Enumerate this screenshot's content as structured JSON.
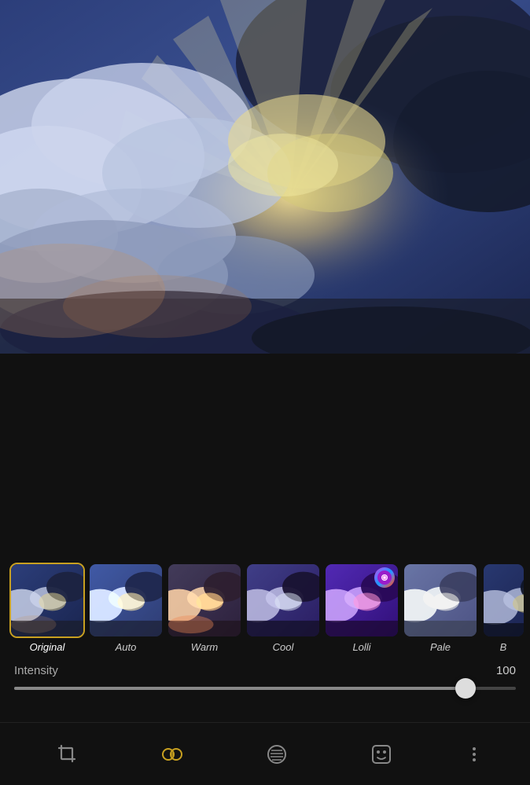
{
  "photo": {
    "alt": "Sky with dramatic clouds and sunbeams"
  },
  "filters": [
    {
      "id": "original",
      "label": "Original",
      "active": true,
      "badge": false
    },
    {
      "id": "auto",
      "label": "Auto",
      "active": false,
      "badge": false
    },
    {
      "id": "warm",
      "label": "Warm",
      "active": false,
      "badge": false
    },
    {
      "id": "cool",
      "label": "Cool",
      "active": false,
      "badge": false
    },
    {
      "id": "lolli",
      "label": "Lolli",
      "active": false,
      "badge": true
    },
    {
      "id": "pale",
      "label": "Pale",
      "active": false,
      "badge": false
    },
    {
      "id": "b",
      "label": "B",
      "active": false,
      "badge": false
    }
  ],
  "intensity": {
    "label": "Intensity",
    "value": "100",
    "percent": 90
  },
  "toolbar": {
    "crop_label": "crop-icon",
    "filter_label": "filter-icon",
    "texture_label": "texture-icon",
    "sticker_label": "sticker-icon",
    "more_label": "more-icon"
  }
}
